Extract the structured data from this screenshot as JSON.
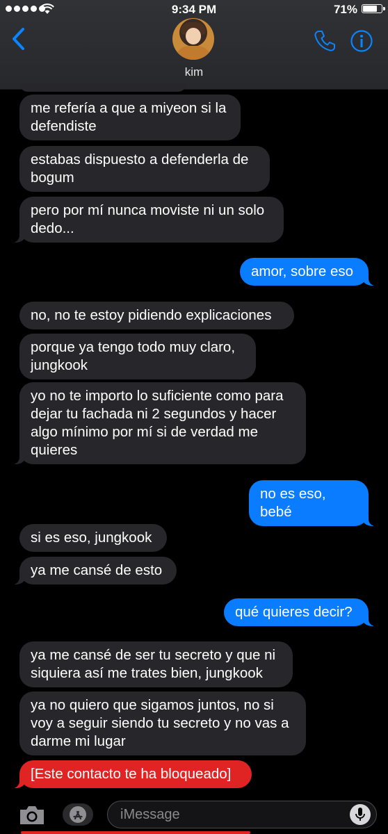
{
  "status_bar": {
    "time": "9:34 PM",
    "battery": "71%",
    "battery_level": 0.71
  },
  "header": {
    "contact_name": "kim"
  },
  "messages": [
    {
      "text": "me refería a que a miyeon si la\ndefendiste",
      "from": "them"
    },
    {
      "text": "estabas dispuesto a defenderla de\nbogum",
      "from": "them"
    },
    {
      "text": "pero por mí nunca moviste ni un solo\ndedo...",
      "from": "them"
    },
    {
      "text": "amor, sobre eso",
      "from": "me"
    },
    {
      "text": "no, no te estoy pidiendo explicaciones",
      "from": "them"
    },
    {
      "text": "porque ya tengo todo muy claro,\njungkook",
      "from": "them"
    },
    {
      "text": "yo no te importo lo suficiente como para\ndejar tu fachada ni 2 segundos y hacer\nalgo mínimo por mí si de verdad me\nquieres",
      "from": "them"
    },
    {
      "text": "no es eso, bebé",
      "from": "me"
    },
    {
      "text": "si es eso, jungkook",
      "from": "them"
    },
    {
      "text": "ya me cansé de esto",
      "from": "them"
    },
    {
      "text": "qué quieres decir?",
      "from": "me"
    },
    {
      "text": "ya me cansé de ser tu secreto y que ni\nsiquiera así me trates bien, jungkook",
      "from": "them"
    },
    {
      "text": "ya no quiero que sigamos juntos, no si\nvoy a seguir siendo tu secreto y no vas a\ndarme mi lugar",
      "from": "them"
    },
    {
      "text": "[Este contacto te ha bloqueado]",
      "from": "system"
    }
  ],
  "input": {
    "placeholder": "iMessage"
  },
  "colors": {
    "outgoing": "#0a7cff",
    "incoming": "#27262b",
    "blocked": "#e02424",
    "accent": "#0a84ff"
  },
  "icons": [
    "back-chevron-icon",
    "phone-icon",
    "info-icon",
    "camera-icon",
    "app-store-icon",
    "microphone-icon"
  ]
}
